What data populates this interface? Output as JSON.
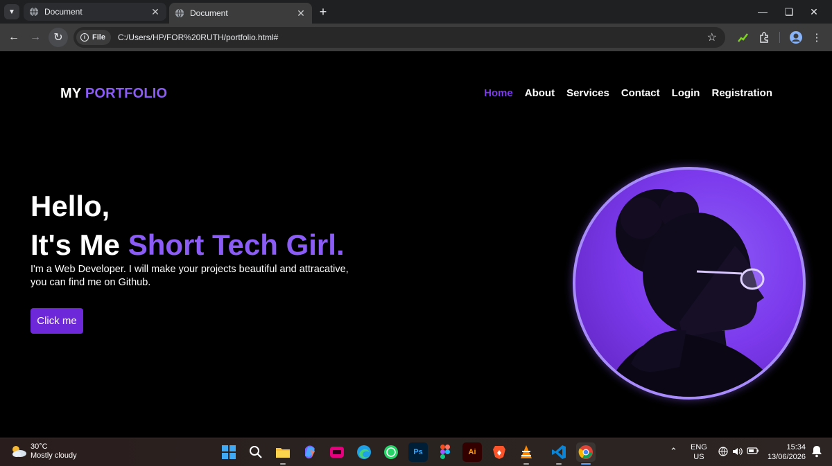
{
  "browser": {
    "tabs": [
      {
        "title": "Document",
        "active": false
      },
      {
        "title": "Document",
        "active": true
      }
    ],
    "address": {
      "scheme_chip": "File",
      "url": "C:/Users/HP/FOR%20RUTH/portfolio.html#"
    }
  },
  "site": {
    "logo": {
      "part1": "MY",
      "part2": "PORTFOLIO"
    },
    "nav": [
      {
        "label": "Home",
        "active": true
      },
      {
        "label": "About",
        "active": false
      },
      {
        "label": "Services",
        "active": false
      },
      {
        "label": "Contact",
        "active": false
      },
      {
        "label": "Login",
        "active": false
      },
      {
        "label": "Registration",
        "active": false
      }
    ],
    "hero": {
      "line1": "Hello,",
      "line2_prefix": "It's Me ",
      "line2_accent": "Short Tech Girl.",
      "intro": "I'm a Web Developer. I will make your projects beautiful and attracative, you can find me on Github.",
      "button_label": "Click me"
    },
    "colors": {
      "accent": "#8b5cf6",
      "button": "#6d28d9",
      "background": "#000000"
    }
  },
  "taskbar": {
    "weather": {
      "temp": "30°C",
      "condition": "Mostly cloudy"
    },
    "apps": [
      "start",
      "search",
      "file-explorer",
      "copilot",
      "app-pink",
      "edge",
      "whatsapp",
      "photoshop",
      "figma",
      "illustrator",
      "brave",
      "vlc",
      "vscode",
      "chrome"
    ],
    "tray": {
      "lang1": "ENG",
      "lang2": "US",
      "time": "15:34",
      "date": "13/06/2026"
    }
  }
}
